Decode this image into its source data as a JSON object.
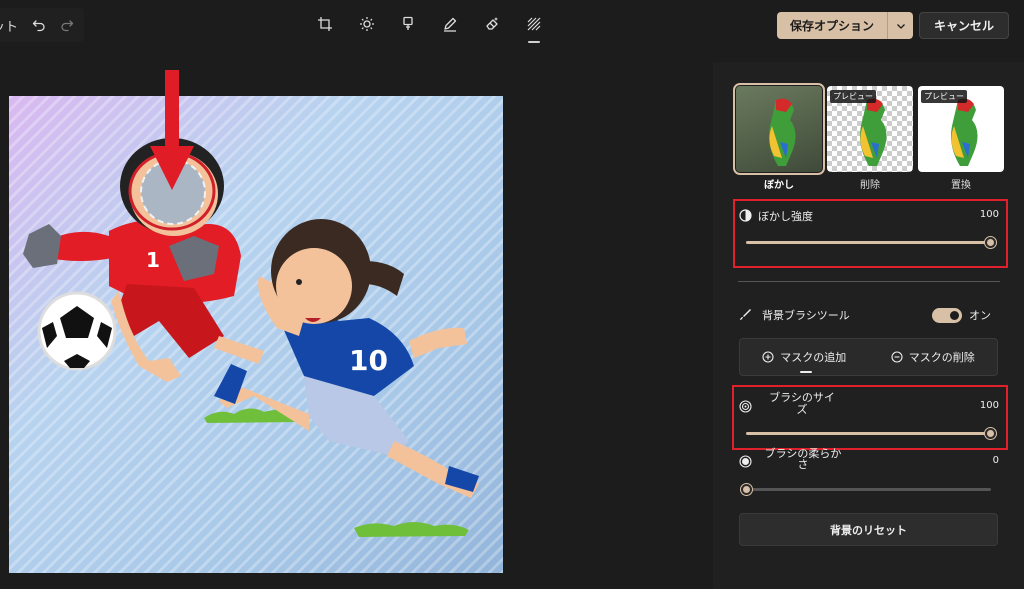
{
  "toolbar": {
    "undo_group_text": "ット",
    "tools": [
      "crop-icon",
      "brightness-icon",
      "filter-icon",
      "markup-icon",
      "erase-icon",
      "background-icon"
    ],
    "active_tool": "background-icon",
    "save_label": "保存オプション",
    "cancel_label": "キャンセル"
  },
  "colors": {
    "accent": "#d8c0a6",
    "highlight_red": "#e0202a",
    "background": "#1c1c1c",
    "panel": "#202020"
  },
  "panel": {
    "modes": [
      {
        "label": "ぼかし",
        "selected": true,
        "preview_tag": ""
      },
      {
        "label": "削除",
        "selected": false,
        "preview_tag": "プレビュー"
      },
      {
        "label": "置換",
        "selected": false,
        "preview_tag": "プレビュー"
      }
    ],
    "blur_strength": {
      "label": "ぼかし強度",
      "value": "100",
      "level": 1.0
    },
    "brush_tool": {
      "label": "背景ブラシツール",
      "toggle_text": "オン",
      "on": true
    },
    "mask": {
      "add_label": "マスクの追加",
      "remove_label": "マスクの削除"
    },
    "brush_size": {
      "label_line1": "ブラシのサイ",
      "label_line2": "ズ",
      "value": "100",
      "level": 1.0
    },
    "brush_softness": {
      "label_line1": "ブラシの柔らか",
      "label_line2": "さ",
      "value": "0",
      "level": 0.0
    },
    "reset_label": "背景のリセット"
  }
}
